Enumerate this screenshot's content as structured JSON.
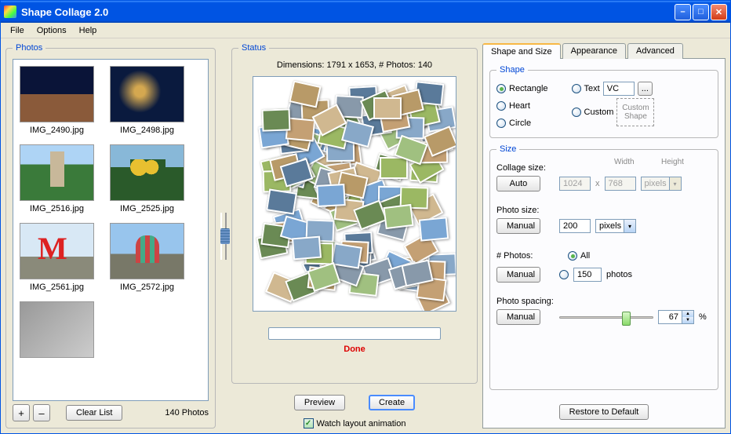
{
  "window": {
    "title": "Shape Collage 2.0"
  },
  "menu": {
    "file": "File",
    "options": "Options",
    "help": "Help"
  },
  "photos": {
    "legend": "Photos",
    "items": [
      {
        "file": "IMG_2490.jpg",
        "cls": "church-night"
      },
      {
        "file": "IMG_2498.jpg",
        "cls": "domes-night"
      },
      {
        "file": "IMG_2516.jpg",
        "cls": "tower-trees"
      },
      {
        "file": "IMG_2525.jpg",
        "cls": "gold-domes"
      },
      {
        "file": "IMG_2561.jpg",
        "cls": "metro"
      },
      {
        "file": "IMG_2572.jpg",
        "cls": "basil"
      },
      {
        "file": "",
        "cls": "gray"
      }
    ],
    "add": "+",
    "remove": "–",
    "clear": "Clear List",
    "count": "140 Photos"
  },
  "status": {
    "legend": "Status",
    "dimensions": "Dimensions: 1791 x 1653, # Photos: 140",
    "done": "Done",
    "preview": "Preview",
    "create": "Create",
    "watch": "Watch layout animation"
  },
  "tabs": {
    "shape_size": "Shape and Size",
    "appearance": "Appearance",
    "advanced": "Advanced"
  },
  "shape": {
    "legend": "Shape",
    "rectangle": "Rectangle",
    "heart": "Heart",
    "circle": "Circle",
    "text": "Text",
    "text_value": "VC",
    "browse": "...",
    "custom": "Custom",
    "custom_btn": "Custom Shape"
  },
  "size": {
    "legend": "Size",
    "collage_label": "Collage size:",
    "collage_mode": "Auto",
    "width_label": "Width",
    "width_val": "1024",
    "height_label": "Height",
    "height_val": "768",
    "x": "x",
    "units": "pixels",
    "photo_label": "Photo size:",
    "photo_mode": "Manual",
    "photo_val": "200",
    "num_label": "# Photos:",
    "num_mode": "Manual",
    "num_all": "All",
    "num_val": "150",
    "num_unit": "photos",
    "spacing_label": "Photo spacing:",
    "spacing_mode": "Manual",
    "spacing_val": "67",
    "spacing_unit": "%"
  },
  "restore": "Restore to Default"
}
